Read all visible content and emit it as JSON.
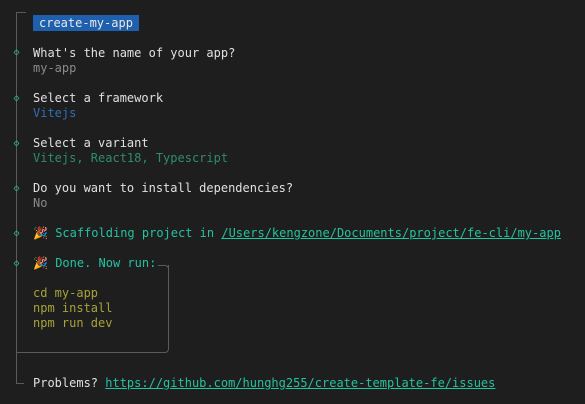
{
  "header": {
    "badge": "create-my-app"
  },
  "steps": [
    {
      "question": "What's the name of your app?",
      "answer": "my-app"
    },
    {
      "question": "Select a framework",
      "answer": "Vitejs"
    },
    {
      "question": "Select a variant",
      "answer": "Vitejs, React18, Typescript"
    },
    {
      "question": "Do you want to install dependencies?",
      "answer": "No"
    }
  ],
  "scaffold": {
    "emoji": "🎉",
    "text": "Scaffolding project in ",
    "path": "/Users/kengzone/Documents/project/fe-cli/my-app"
  },
  "done": {
    "emoji": "🎉",
    "text": "Done. Now run:"
  },
  "commands": [
    "cd my-app",
    "npm install",
    "npm run dev"
  ],
  "footer": {
    "label": "Problems? ",
    "link": "https://github.com/hunghg255/create-template-fe/issues"
  },
  "colors": {
    "accent": "#23c3a0",
    "badge_bg": "#1e5fae",
    "command": "#a8a23a"
  }
}
